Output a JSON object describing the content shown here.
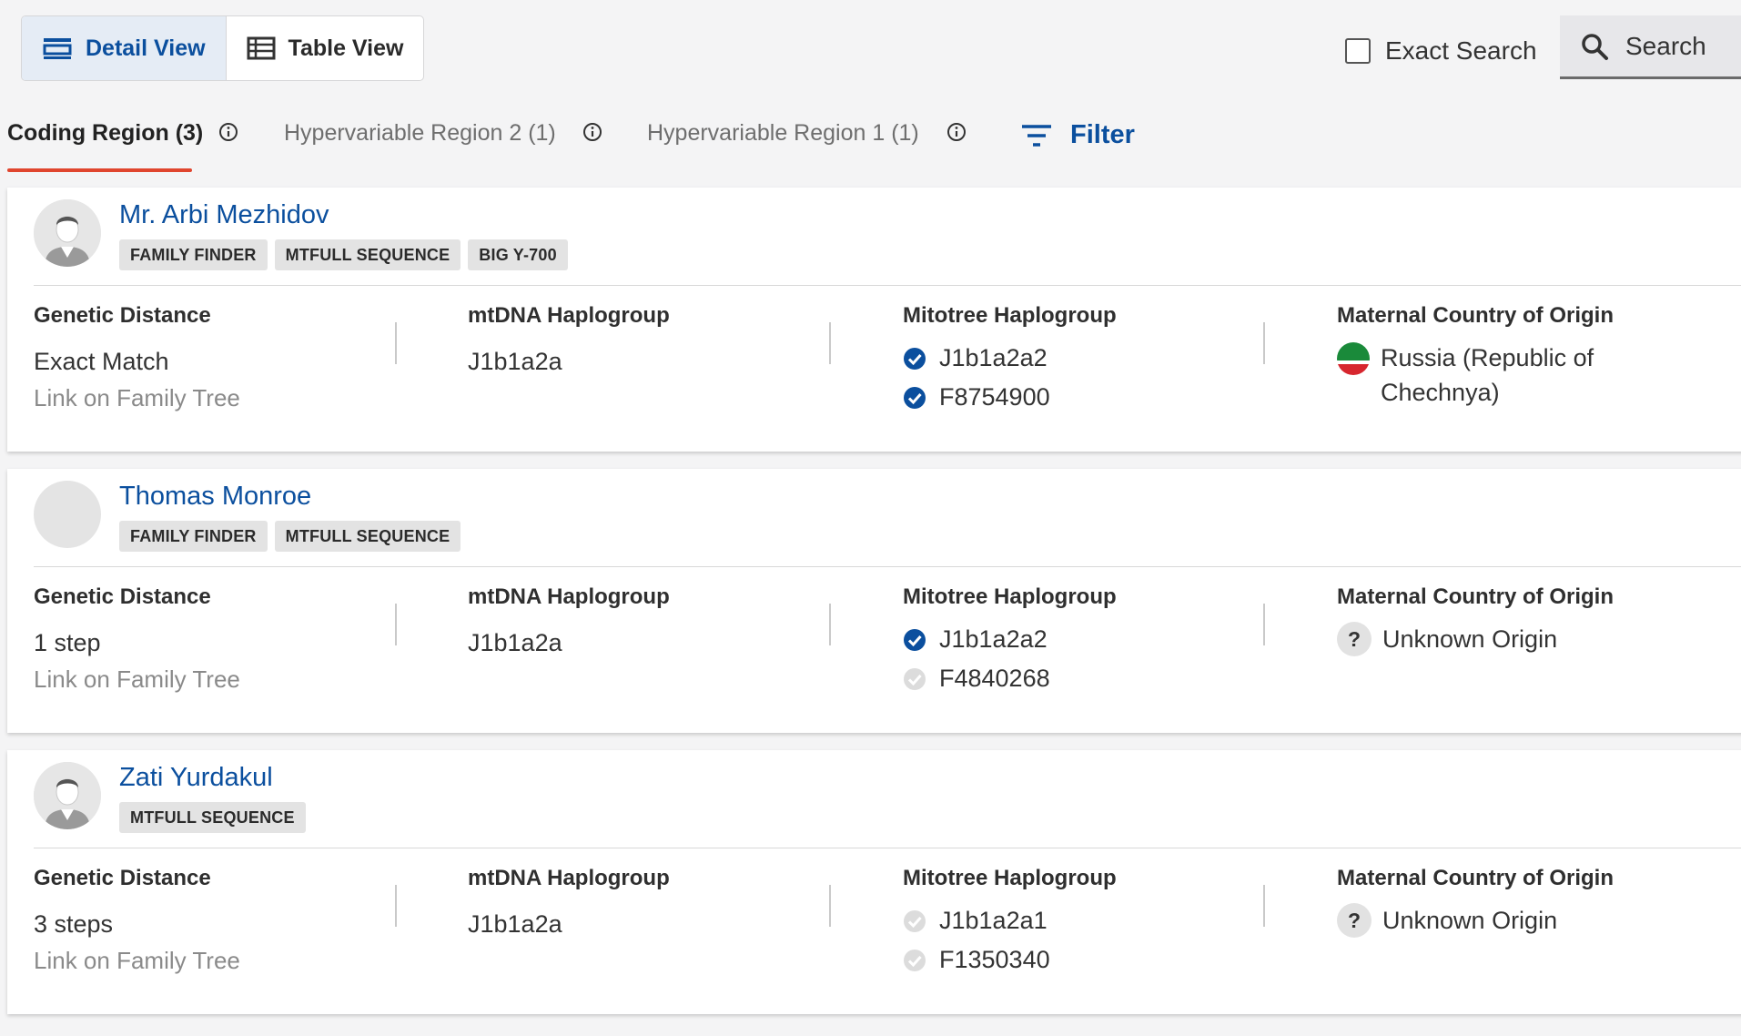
{
  "toolbar": {
    "detail_view_label": "Detail View",
    "table_view_label": "Table View",
    "exact_search_label": "Exact Search",
    "search_label": "Search"
  },
  "tabs": [
    {
      "label": "Coding Region (3)",
      "active": true
    },
    {
      "label": "Hypervariable Region 2 (1)",
      "active": false
    },
    {
      "label": "Hypervariable Region 1 (1)",
      "active": false
    }
  ],
  "filter_label": "Filter",
  "columns": {
    "genetic_distance": "Genetic Distance",
    "mtdna_haplogroup": "mtDNA Haplogroup",
    "mitotree_haplogroup": "Mitotree Haplogroup",
    "maternal_origin": "Maternal Country of Origin"
  },
  "link_on_tree_label": "Link on Family Tree",
  "matches": [
    {
      "name": "Mr. Arbi Mezhidov",
      "badges": [
        "FAMILY FINDER",
        "MTFULL SEQUENCE",
        "BIG Y-700"
      ],
      "genetic_distance": "Exact Match",
      "mtdna_haplogroup": "J1b1a2a",
      "mitotree": [
        {
          "value": "J1b1a2a2",
          "verified": true
        },
        {
          "value": "F8754900",
          "verified": true
        }
      ],
      "origin": "Russia (Republic of Chechnya)",
      "origin_flag_colors": [
        "#1a8a3a",
        "#ffffff",
        "#d7262e"
      ]
    },
    {
      "name": "Thomas Monroe",
      "badges": [
        "FAMILY FINDER",
        "MTFULL SEQUENCE"
      ],
      "genetic_distance": "1 step",
      "mtdna_haplogroup": "J1b1a2a",
      "mitotree": [
        {
          "value": "J1b1a2a2",
          "verified": true
        },
        {
          "value": "F4840268",
          "verified": false
        }
      ],
      "origin": "Unknown Origin"
    },
    {
      "name": "Zati Yurdakul",
      "badges": [
        "MTFULL SEQUENCE"
      ],
      "genetic_distance": "3 steps",
      "mtdna_haplogroup": "J1b1a2a",
      "mitotree": [
        {
          "value": "J1b1a2a1",
          "verified": false
        },
        {
          "value": "F1350340",
          "verified": false
        }
      ],
      "origin": "Unknown Origin"
    }
  ],
  "colors": {
    "accent_blue": "#0b4f9e",
    "tab_underline": "#e0452e",
    "verified_check": "#0b4f9e",
    "unverified_check": "#d9d9d9"
  },
  "icons": {
    "detail_view": "detail-view-icon",
    "table_view": "table-view-icon",
    "search": "search-icon",
    "filter": "filter-icon",
    "info": "info-icon",
    "check": "check-circle-icon",
    "unknown": "question-mark-icon"
  }
}
